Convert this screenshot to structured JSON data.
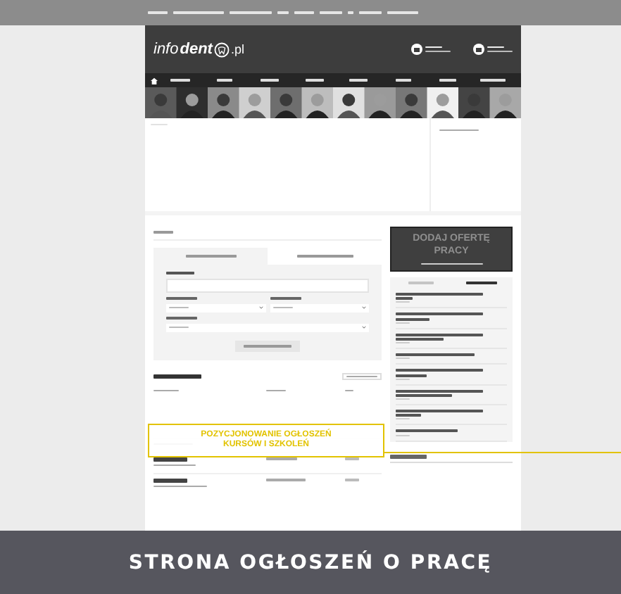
{
  "header": {
    "logo": {
      "prefix": "info",
      "main": "dent",
      "suffix": ".pl"
    }
  },
  "search_tabs": [
    {
      "selected": true
    },
    {
      "selected": false
    }
  ],
  "promo": {
    "title": "DODAJ OFERTĘ PRACY"
  },
  "news_tabs": [
    {
      "selected": false
    },
    {
      "selected": true
    }
  ],
  "highlight": {
    "lines": [
      "POZYCJONOWANIE OGŁOSZEŃ",
      "KURSÓW I SZKOLEŃ"
    ]
  },
  "caption": "STRONA OGŁOSZEŃ O PRACĘ"
}
